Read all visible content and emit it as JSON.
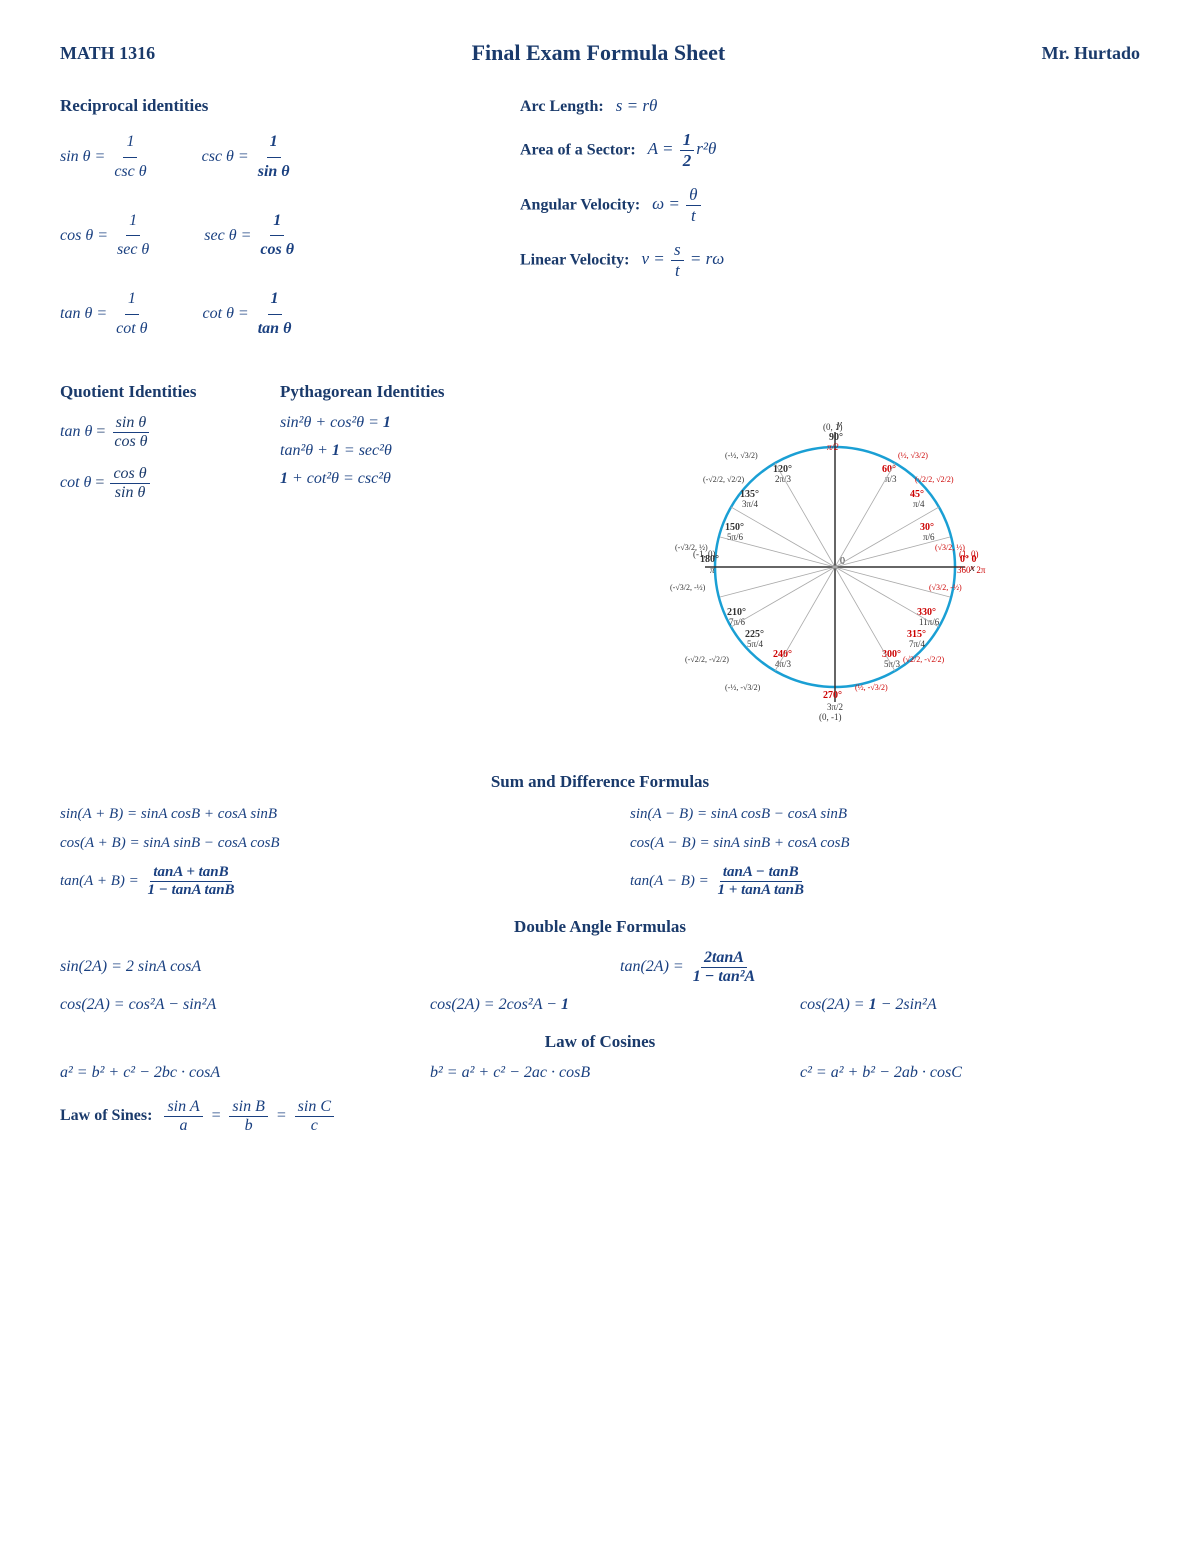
{
  "header": {
    "course": "MATH 1316",
    "title": "Final Exam Formula Sheet",
    "instructor": "Mr. Hurtado"
  },
  "sections": {
    "reciprocal_identities": {
      "title": "Reciprocal identities"
    },
    "arc_length": {
      "label": "Arc Length:",
      "formula": "s = rθ"
    },
    "area_sector": {
      "label": "Area of a Sector:",
      "formula": "A = ½r²θ"
    },
    "angular_velocity": {
      "label": "Angular Velocity:",
      "formula": "ω = θ/t"
    },
    "linear_velocity": {
      "label": "Linear Velocity:",
      "formula": "v = s/t = rω"
    },
    "quotient_identities": {
      "title": "Quotient Identities"
    },
    "pythagorean_identities": {
      "title": "Pythagorean Identities"
    },
    "sum_diff": {
      "title": "Sum and Difference Formulas"
    },
    "double_angle": {
      "title": "Double Angle Formulas"
    },
    "law_of_cosines": {
      "title": "Law of Cosines"
    },
    "law_of_sines": {
      "label": "Law of Sines:"
    }
  }
}
